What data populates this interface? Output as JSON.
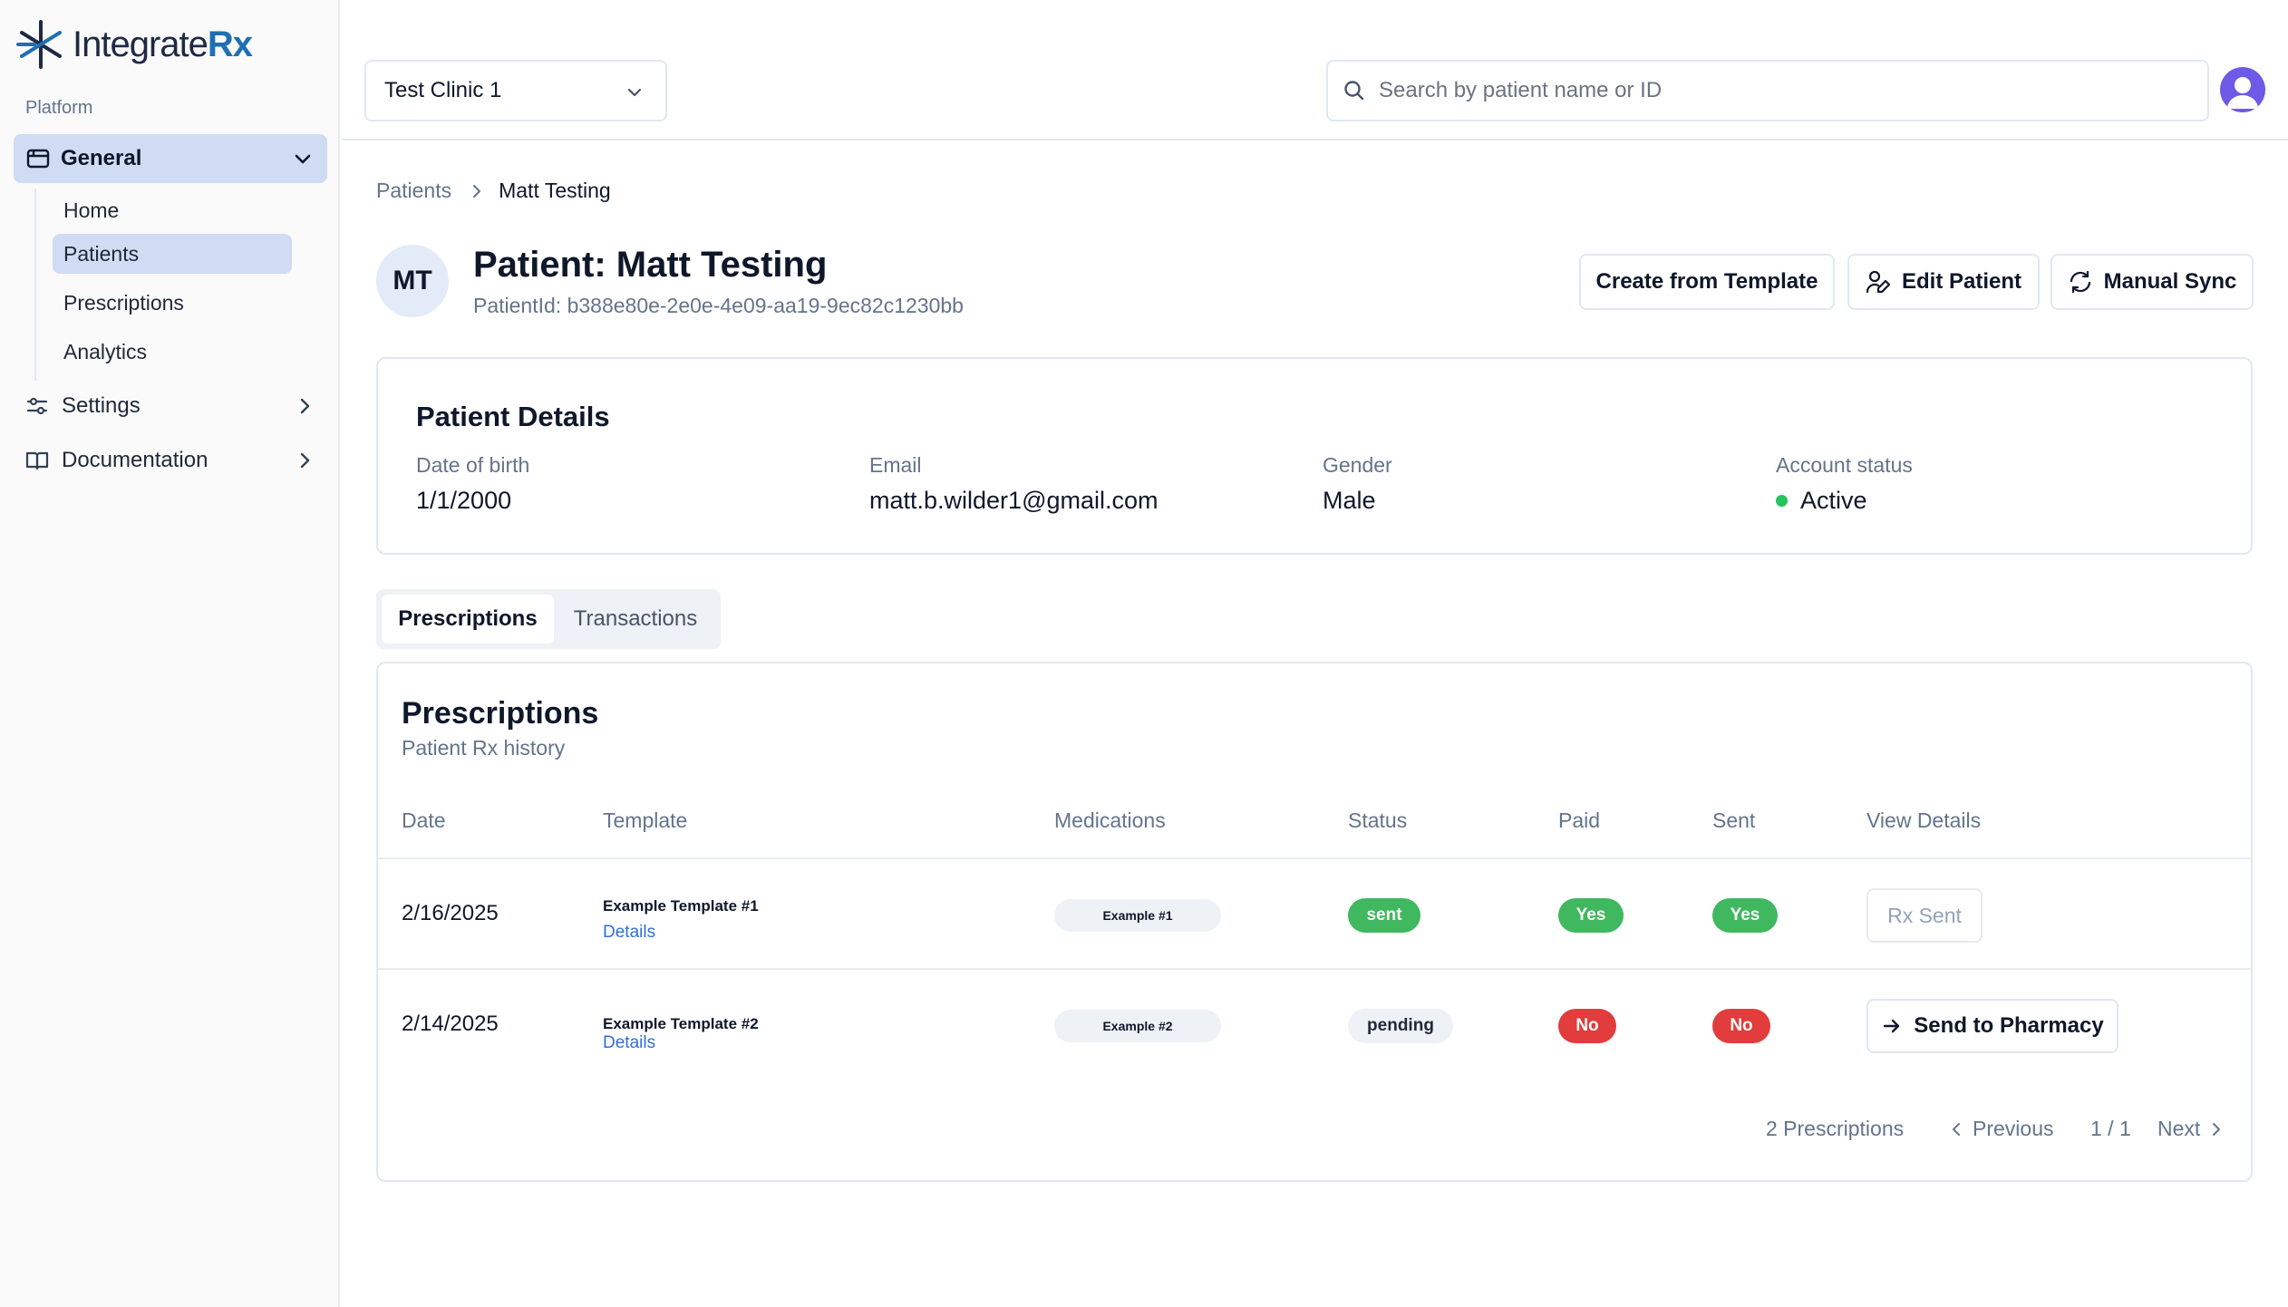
{
  "app": {
    "logo_text_main": "Integrate",
    "logo_text_accent": "Rx",
    "accent_color": "#cfdcf4"
  },
  "sidebar": {
    "section_label": "Platform",
    "general_label": "General",
    "sub_items": [
      {
        "label": "Home"
      },
      {
        "label": "Patients"
      },
      {
        "label": "Prescriptions"
      },
      {
        "label": "Analytics"
      }
    ],
    "settings_label": "Settings",
    "documentation_label": "Documentation"
  },
  "topbar": {
    "clinic_value": "Test Clinic 1",
    "search_placeholder": "Search by patient name or ID"
  },
  "breadcrumb": {
    "root": "Patients",
    "current": "Matt Testing"
  },
  "patient": {
    "initials": "MT",
    "title": "Patient: Matt Testing",
    "id_line": "PatientId: b388e80e-2e0e-4e09-aa19-9ec82c1230bb"
  },
  "actions": {
    "create_template": "Create from Template",
    "edit_patient": "Edit Patient",
    "manual_sync": "Manual Sync"
  },
  "details": {
    "title": "Patient Details",
    "dob_label": "Date of birth",
    "dob_value": "1/1/2000",
    "email_label": "Email",
    "email_value": "matt.b.wilder1@gmail.com",
    "gender_label": "Gender",
    "gender_value": "Male",
    "status_label": "Account status",
    "status_value": "Active",
    "status_color": "#22c55e"
  },
  "tabs": [
    {
      "label": "Prescriptions",
      "active": true
    },
    {
      "label": "Transactions",
      "active": false
    }
  ],
  "prescriptions": {
    "title": "Prescriptions",
    "subtitle": "Patient Rx history",
    "columns": [
      "Date",
      "Template",
      "Medications",
      "Status",
      "Paid",
      "Sent",
      "View Details"
    ],
    "rows": [
      {
        "date": "2/16/2025",
        "template": "Example Template #1",
        "details_link": "Details",
        "medication": "Example #1",
        "status": "sent",
        "paid": "Yes",
        "sent": "Yes",
        "action": "Rx Sent"
      },
      {
        "date": "2/14/2025",
        "template": "Example Template #2",
        "details_link": "Details",
        "medication": "Example #2",
        "status": "pending",
        "paid": "No",
        "sent": "No",
        "action": "Send to Pharmacy"
      }
    ],
    "pagination": {
      "count": "2 Prescriptions",
      "previous": "Previous",
      "page": "1 / 1",
      "next": "Next"
    }
  }
}
